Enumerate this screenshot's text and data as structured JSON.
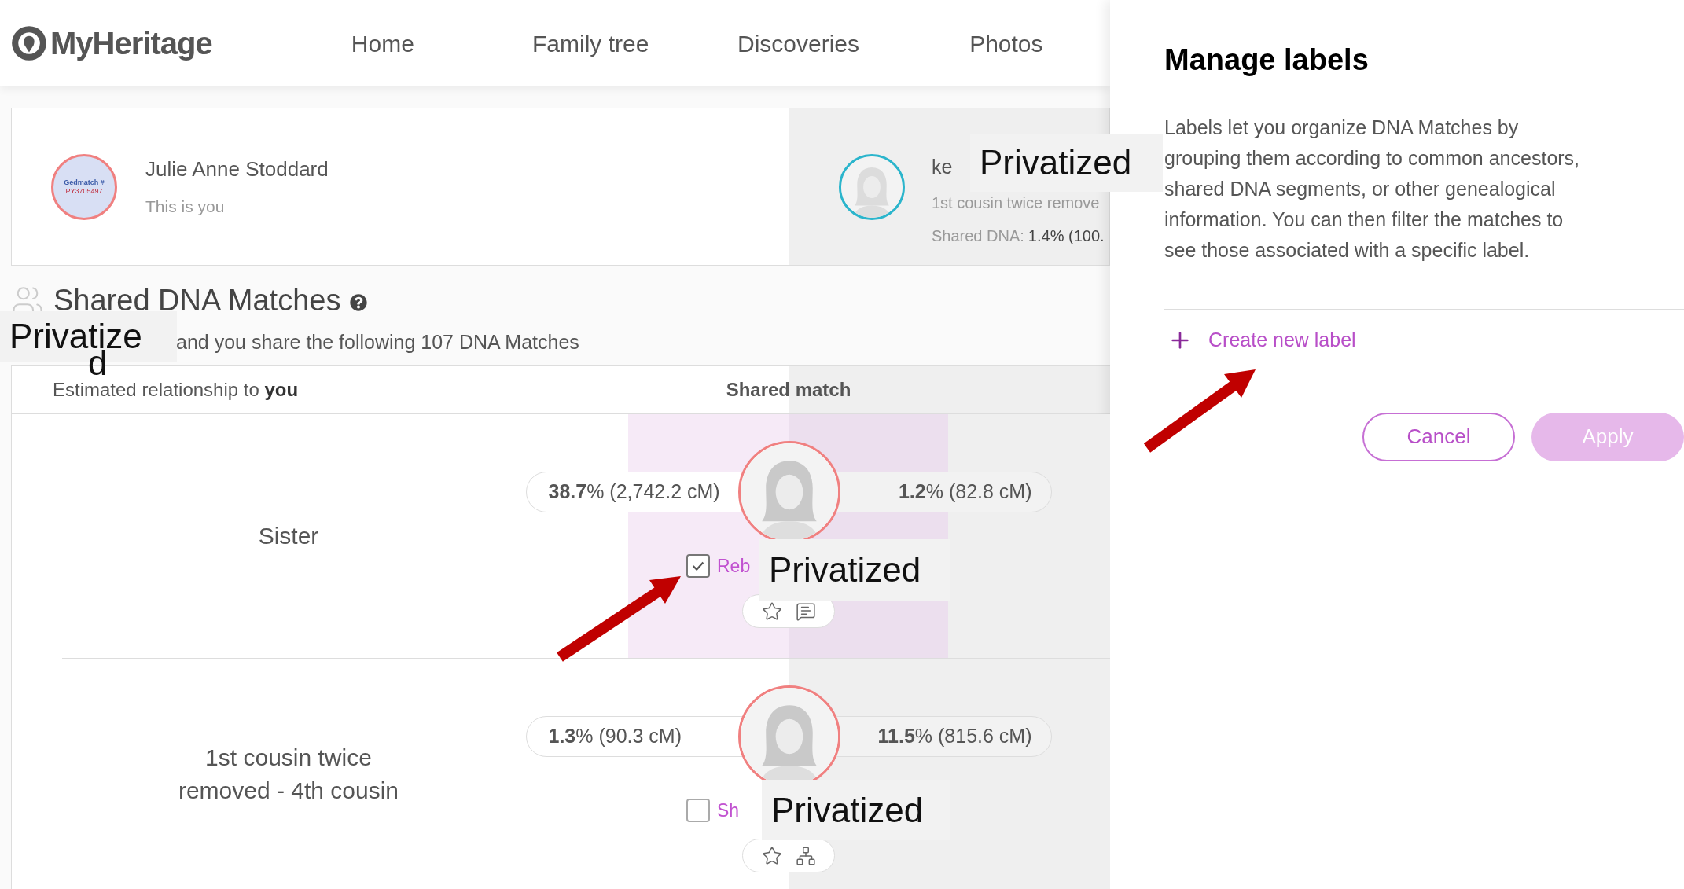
{
  "nav": {
    "logo": "MyHeritage",
    "items": [
      "Home",
      "Family tree",
      "Discoveries",
      "Photos"
    ]
  },
  "profile_card": {
    "you": {
      "avatar_lines": [
        "Gedmatch #",
        "PY3705497"
      ],
      "name": "Julie Anne Stoddard",
      "subtitle": "This is you"
    },
    "match": {
      "name": "ke",
      "relationship": "1st cousin twice remove",
      "shared_dna_label": "Shared DNA:",
      "shared_dna_value": "1.4% (100."
    }
  },
  "section": {
    "title": "Shared DNA Matches",
    "subtitle": "and you share the following 107 DNA Matches"
  },
  "table": {
    "columns": [
      "Estimated relationship to **you**",
      "Shared match"
    ],
    "rows": [
      {
        "relationship": "Sister",
        "shared_with_you": "**38.7**% (2,742.2 cM)",
        "shared_with_match": "**1.2**% (82.8 cM)",
        "checked": true,
        "label": "Reb",
        "kind": "note"
      },
      {
        "relationship": "1st cousin twice removed - 4th cousin",
        "shared_with_you": "**1.3**% (90.3 cM)",
        "shared_with_match": "**11.5**% (815.6 cM)",
        "checked": false,
        "label": "Sh",
        "kind": "tree"
      }
    ]
  },
  "redactions": [
    "Privatized",
    "Privatize",
    "d",
    "Privatized",
    "Privatized"
  ],
  "panel": {
    "title": "Manage labels",
    "description": "Labels let you organize DNA Matches by grouping them according to common ancestors, shared DNA segments, or other genealogical information. You can then filter the matches to see those associated with a specific label.",
    "create_label": "Create new label",
    "buttons": [
      {
        "label": "Cancel",
        "kind": "secondary",
        "disabled": false
      },
      {
        "label": "Apply",
        "kind": "primary",
        "disabled": true
      }
    ]
  }
}
